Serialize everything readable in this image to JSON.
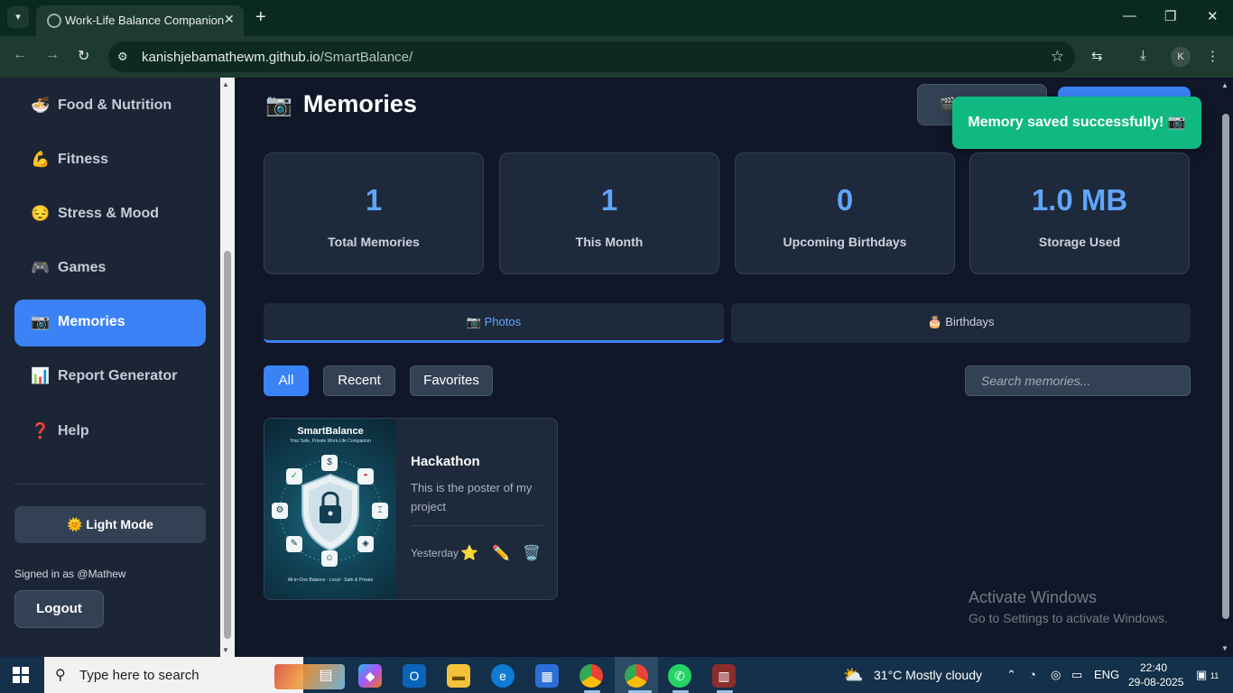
{
  "browser": {
    "tab_title": "Work-Life Balance Companion",
    "url_domain": "kanishjebamathewm.github.io",
    "url_path": "/SmartBalance/",
    "profile_initial": "K"
  },
  "sidebar": {
    "items": [
      {
        "emoji": "🍜",
        "label": "Food & Nutrition"
      },
      {
        "emoji": "💪",
        "label": "Fitness"
      },
      {
        "emoji": "😔",
        "label": "Stress & Mood"
      },
      {
        "emoji": "🎮",
        "label": "Games"
      },
      {
        "emoji": "📷",
        "label": "Memories"
      },
      {
        "emoji": "📊",
        "label": "Report Generator"
      },
      {
        "emoji": "❓",
        "label": "Help"
      }
    ],
    "mode_button": "🌞 Light Mode",
    "signed_in": "Signed in as @Mathew",
    "logout": "Logout"
  },
  "main": {
    "title_emoji": "📷",
    "title": "Memories",
    "header_button_emoji": "🎬",
    "toast": "Memory saved successfully! 📷",
    "stats": [
      {
        "value": "1",
        "label": "Total Memories"
      },
      {
        "value": "1",
        "label": "This Month"
      },
      {
        "value": "0",
        "label": "Upcoming Birthdays"
      },
      {
        "value": "1.0 MB",
        "label": "Storage Used"
      }
    ],
    "tabs": [
      {
        "label": "📷 Photos",
        "active": true
      },
      {
        "label": "🎂 Birthdays",
        "active": false
      }
    ],
    "filters": [
      "All",
      "Recent",
      "Favorites"
    ],
    "search_placeholder": "Search memories...",
    "memory": {
      "poster_title": "SmartBalance",
      "poster_subtitle": "Your Safe, Private Work-Life Companion",
      "poster_footer": "All-in-One Balance · Local · Safe & Private",
      "title": "Hackathon",
      "description": "This is the poster of my project",
      "date": "Yesterday",
      "actions": {
        "favorite": "⭐",
        "edit": "✏️",
        "delete": "🗑️"
      }
    },
    "watermark": {
      "line1": "Activate Windows",
      "line2": "Go to Settings to activate Windows."
    }
  },
  "taskbar": {
    "search_placeholder": "Type here to search",
    "weather_temp": "31°C",
    "weather_text": "Mostly cloudy",
    "language": "ENG",
    "time": "22:40",
    "date": "29-08-2025",
    "notification_count": "11"
  },
  "colors": {
    "accent": "#3b82f6",
    "toast": "#10b981",
    "stat_value": "#60a5fa",
    "background": "#0f1729",
    "sidebar": "#1b2536"
  }
}
